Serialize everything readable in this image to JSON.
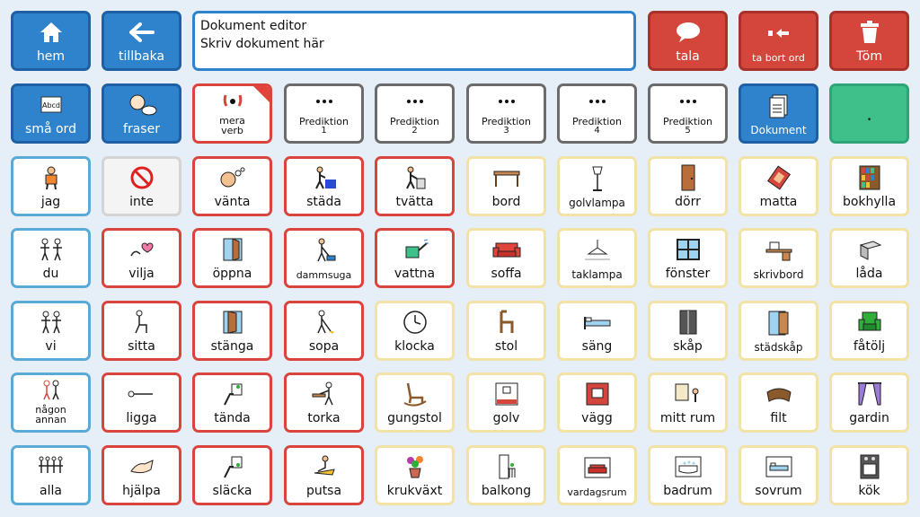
{
  "editor": {
    "title": "Dokument editor",
    "text": "Skriv dokument här"
  },
  "top_left": [
    {
      "label": "hem",
      "icon": "home-icon"
    },
    {
      "label": "tillbaka",
      "icon": "arrow-left-icon"
    }
  ],
  "top_right": [
    {
      "label": "tala",
      "icon": "speech-bubble-icon"
    },
    {
      "label": "ta bort ord",
      "icon": "delete-word-icon"
    },
    {
      "label": "Töm",
      "icon": "trash-icon"
    }
  ],
  "row2": [
    {
      "label": "små ord",
      "icon": "abcd-card-icon"
    },
    {
      "label": "fraser",
      "icon": "speaking-head-icon"
    },
    {
      "label": "mera verb",
      "icon": "face-icon"
    },
    {
      "label": "Prediktion",
      "num": "1"
    },
    {
      "label": "Prediktion",
      "num": "2"
    },
    {
      "label": "Prediktion",
      "num": "3"
    },
    {
      "label": "Prediktion",
      "num": "4"
    },
    {
      "label": "Prediktion",
      "num": "5"
    },
    {
      "label": "Dokument",
      "icon": "document-icon"
    },
    {
      "label": "."
    }
  ],
  "grid": [
    [
      "jag",
      "inte",
      "vänta",
      "städa",
      "tvätta",
      "bord",
      "golvlampa",
      "dörr",
      "matta",
      "bokhylla"
    ],
    [
      "du",
      "vilja",
      "öppna",
      "dammsuga",
      "vattna",
      "soffa",
      "taklampa",
      "fönster",
      "skrivbord",
      "låda"
    ],
    [
      "vi",
      "sitta",
      "stänga",
      "sopa",
      "klocka",
      "stol",
      "säng",
      "skåp",
      "städskåp",
      "fåtölj"
    ],
    [
      "någon annan",
      "ligga",
      "tända",
      "torka",
      "gungstol",
      "golv",
      "vägg",
      "mitt rum",
      "filt",
      "gardin"
    ],
    [
      "alla",
      "hjälpa",
      "släcka",
      "putsa",
      "krukväxt",
      "balkong",
      "vardagsrum",
      "badrum",
      "sovrum",
      "kök"
    ]
  ],
  "colors": {
    "blue": "#2f83cc",
    "red": "#d4453c",
    "green": "#3fc08b",
    "yellow": "#f3e2a6"
  }
}
